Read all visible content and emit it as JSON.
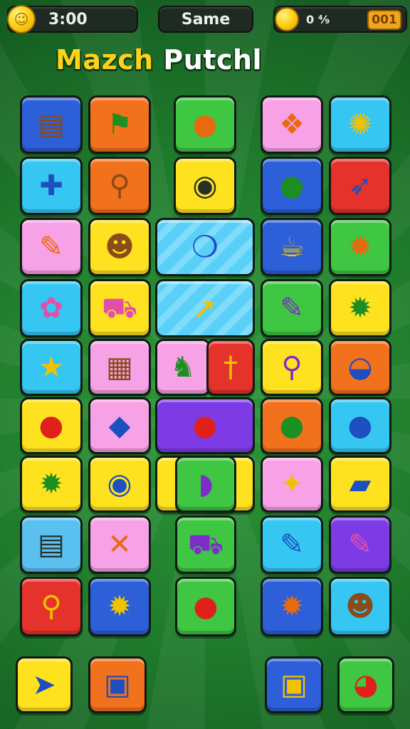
{
  "hud": {
    "timer": "3:00",
    "mode": "Same",
    "coins": "0 ⁴⁄₉",
    "level_badge": "001"
  },
  "title": {
    "part1": "Mazch",
    "part2": "Putchl"
  },
  "icons": {
    "timer_coin": "☺",
    "coin": "●"
  },
  "grid": {
    "row1": [
      "▤",
      "⚑",
      "●",
      "❖",
      "✺"
    ],
    "row2": [
      "✚",
      "⚲",
      "◉",
      "●",
      "➶"
    ],
    "row3": [
      "✎",
      "☻",
      "❍",
      "☕",
      "✹"
    ],
    "row4": [
      "✿",
      "⛟",
      "➚",
      "✎",
      "✹"
    ],
    "row5": [
      "★",
      "▦",
      "♞",
      "†",
      "⚲",
      "◒"
    ],
    "row6": [
      "●",
      "◆",
      "●",
      "●",
      "●"
    ],
    "row7": [
      "✹",
      "◉",
      "◗",
      "✦",
      "▰"
    ],
    "row8": [
      "▤",
      "✕",
      "⛟",
      "✎",
      "✎"
    ],
    "row9": [
      "⚲",
      "✹",
      "●",
      "✹",
      "☻"
    ]
  },
  "bottom": {
    "b1": "➤",
    "b2": "▣",
    "b3": "▣",
    "b4": "◕"
  },
  "colors": {
    "background": "#1f7a2c",
    "title_yellow": "#ffd21a",
    "hud_dark": "#1e2a22"
  }
}
